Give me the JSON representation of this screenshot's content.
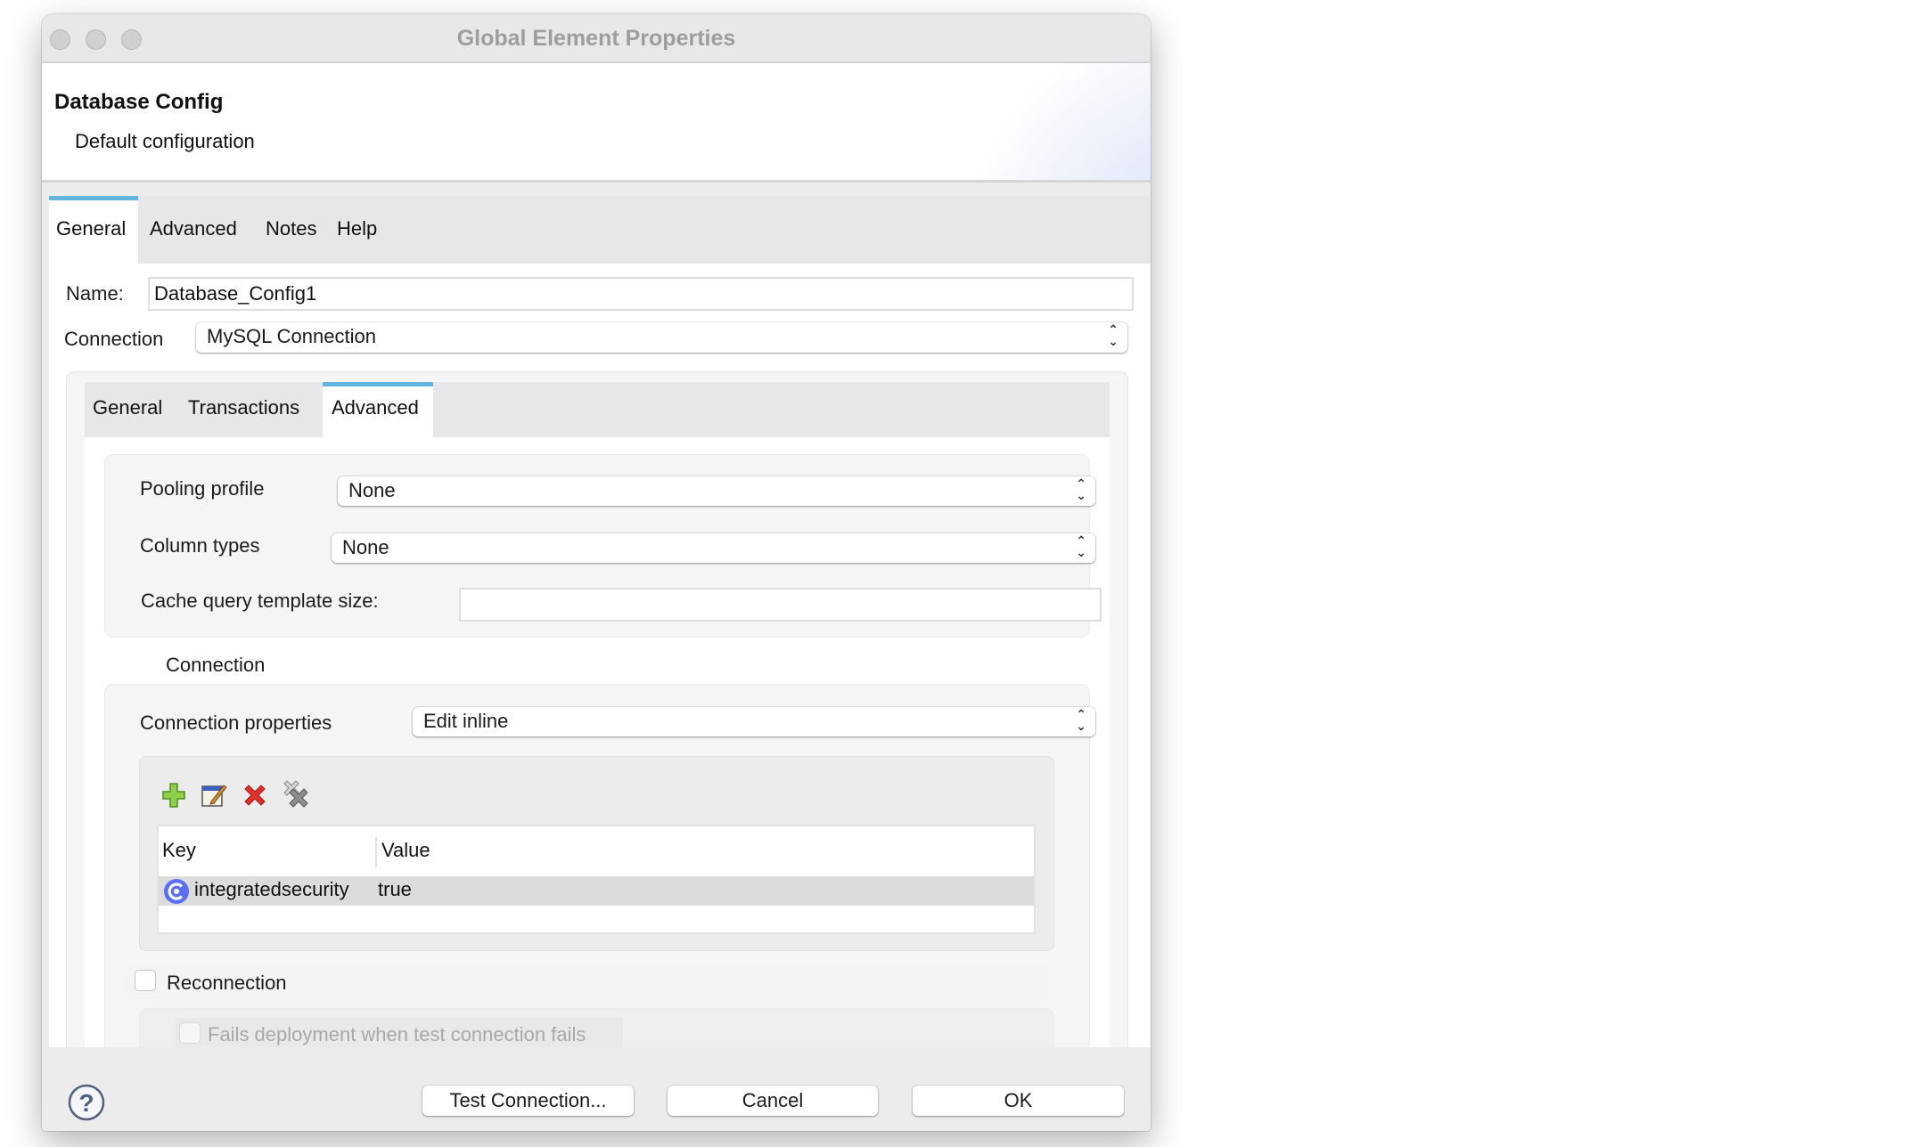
{
  "window": {
    "title": "Global Element Properties"
  },
  "header": {
    "title": "Database Config",
    "subtitle": "Default configuration"
  },
  "top_tabs": [
    {
      "label": "General",
      "active": true
    },
    {
      "label": "Advanced",
      "active": false
    },
    {
      "label": "Notes",
      "active": false
    },
    {
      "label": "Help",
      "active": false
    }
  ],
  "form": {
    "name_label": "Name:",
    "name_value": "Database_Config1",
    "connection_label": "Connection",
    "connection_value": "MySQL Connection"
  },
  "inner_tabs": [
    {
      "label": "General",
      "active": false
    },
    {
      "label": "Transactions",
      "active": false
    },
    {
      "label": "Advanced",
      "active": true
    }
  ],
  "advanced": {
    "pooling_profile_label": "Pooling profile",
    "pooling_profile_value": "None",
    "column_types_label": "Column types",
    "column_types_value": "None",
    "cache_query_label": "Cache query template size:",
    "cache_query_value": ""
  },
  "connection_section": {
    "title": "Connection",
    "properties_label": "Connection properties",
    "properties_value": "Edit inline",
    "toolbar": {
      "add": "add-icon",
      "edit": "edit-icon",
      "delete": "delete-icon",
      "delete_all": "delete-all-icon"
    },
    "table": {
      "columns": [
        "Key",
        "Value"
      ],
      "rows": [
        {
          "key": "integratedsecurity",
          "value": "true",
          "icon": "property-icon",
          "selected": true
        }
      ]
    },
    "reconnection_label": "Reconnection",
    "reconnection_checked": false,
    "fails_deployment_label": "Fails deployment when test connection fails",
    "fails_deployment_checked": false
  },
  "footer": {
    "help_icon": "help-icon",
    "test_connection": "Test Connection...",
    "cancel": "Cancel",
    "ok": "OK"
  },
  "colors": {
    "active_tab_accent": "#62b5df",
    "delete_icon": "#e0312e",
    "add_icon": "#5cae2e",
    "property_icon": "#5b6ef5"
  }
}
